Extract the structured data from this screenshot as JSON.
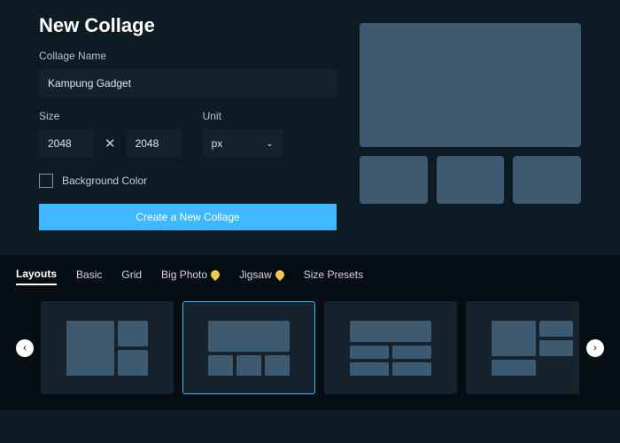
{
  "header": {
    "title": "New Collage"
  },
  "form": {
    "name_label": "Collage Name",
    "name_value": "Kampung Gadget",
    "size_label": "Size",
    "unit_label": "Unit",
    "width_value": "2048",
    "height_value": "2048",
    "x_separator": "✕",
    "unit_value": "px",
    "bg_label": "Background Color",
    "bg_checked": false,
    "create_label": "Create a New Collage"
  },
  "tabs": [
    {
      "label": "Layouts",
      "active": true,
      "premium": false
    },
    {
      "label": "Basic",
      "active": false,
      "premium": false
    },
    {
      "label": "Grid",
      "active": false,
      "premium": false
    },
    {
      "label": "Big Photo",
      "active": false,
      "premium": true
    },
    {
      "label": "Jigsaw",
      "active": false,
      "premium": true
    },
    {
      "label": "Size Presets",
      "active": false,
      "premium": false
    }
  ],
  "nav": {
    "prev": "‹",
    "next": "›"
  },
  "layouts": [
    {
      "id": "layout-1",
      "selected": false
    },
    {
      "id": "layout-2",
      "selected": true
    },
    {
      "id": "layout-3",
      "selected": false
    },
    {
      "id": "layout-4",
      "selected": false
    },
    {
      "id": "layout-5",
      "selected": false
    }
  ]
}
